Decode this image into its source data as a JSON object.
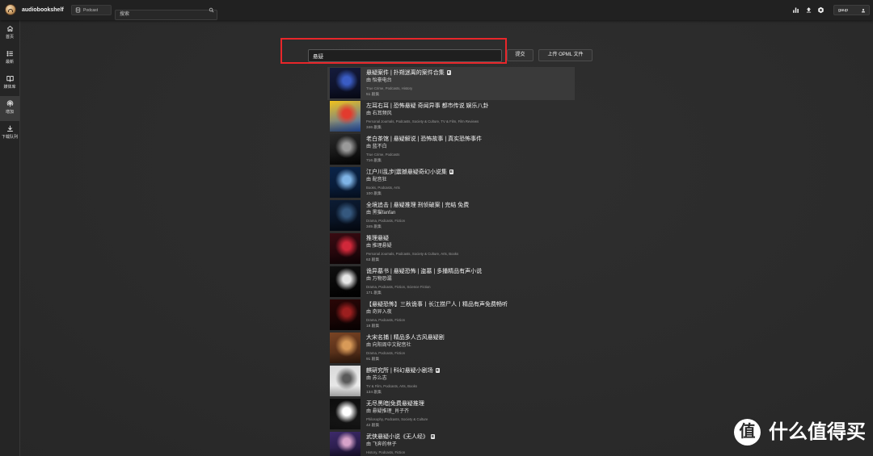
{
  "app": {
    "name": "audiobookshelf",
    "logo_icon": "audiobookshelf-logo-icon"
  },
  "header": {
    "library_selector": {
      "icon": "database-icon",
      "label": "Podcast"
    },
    "search": {
      "icon": "search-icon",
      "placeholder": "搜索"
    },
    "actions": [
      {
        "icon": "stats-icon"
      },
      {
        "icon": "upload-icon"
      },
      {
        "icon": "settings-icon"
      }
    ],
    "user": {
      "name": "gaup",
      "icon": "user-icon"
    }
  },
  "sidebar": {
    "items": [
      {
        "icon": "home-icon",
        "label": "首页",
        "active": false
      },
      {
        "icon": "list-icon",
        "label": "最新",
        "active": false
      },
      {
        "icon": "book-icon",
        "label": "媒体库",
        "active": false
      },
      {
        "icon": "podcast-icon",
        "label": "增加",
        "active": true
      },
      {
        "icon": "download-icon",
        "label": "下载队列",
        "active": false
      }
    ]
  },
  "podcast_search": {
    "query": "悬疑",
    "submit_label": "提交",
    "opml_label": "上传 OPML 文件"
  },
  "annotation": {
    "color": "#e8262a"
  },
  "results": [
    {
      "title": "悬疑案件 | 扑朔迷离的案件合集",
      "badge": "E",
      "author": "由 怡豪电台",
      "categories": "True Crime, Podcasts, History",
      "episodes": "51 剧集",
      "hovered": true,
      "cover_colors": [
        "#151b3c",
        "#3a5cc4",
        "#090c1d"
      ]
    },
    {
      "title": "左耳右耳 | 恐怖悬疑 奇闻异事 都市传说 娱乐八卦",
      "author": "由 右耳频风",
      "categories": "Personal Journals, Podcasts, Society & Culture, TV & Film, Film Reviews",
      "episodes": "346 剧集",
      "hovered": false,
      "cover_colors": [
        "#f2c21c",
        "#e23b2e",
        "#2d5fc4"
      ]
    },
    {
      "title": "老白茶馆 | 悬疑解说 | 恐怖故事 | 真实恐怖事件",
      "author": "由 蓝不白",
      "categories": "True Crime, Podcasts",
      "episodes": "716 剧集",
      "hovered": false,
      "cover_colors": [
        "#2a2a2a",
        "#9a9a9a",
        "#050505"
      ]
    },
    {
      "title": "江户川乱步|震撼悬疑奇幻小说集",
      "badge": "E",
      "author": "由 配音狂",
      "categories": "Books, Podcasts, Arts",
      "episodes": "100 剧集",
      "hovered": false,
      "cover_colors": [
        "#0b2448",
        "#7fb4e6",
        "#06152c"
      ]
    },
    {
      "title": "全境追击 | 悬疑推理 刑侦破案 | 完结 免费",
      "author": "由 黑猫fanfan",
      "categories": "Drama, Podcasts, Fiction",
      "episodes": "345 剧集",
      "hovered": false,
      "cover_colors": [
        "#0c1c34",
        "#35587e",
        "#050b16"
      ]
    },
    {
      "title": "推理悬疑",
      "author": "由 推理悬疑",
      "categories": "Personal Journals, Podcasts, Society & Culture, Arts, Books",
      "episodes": "63 剧集",
      "hovered": false,
      "cover_colors": [
        "#3a0b12",
        "#d1283a",
        "#120306"
      ]
    },
    {
      "title": "诡异墓书 | 悬疑恐怖 | 盗墓 | 多播精品有声小说",
      "author": "由 万物恐漏",
      "categories": "Drama, Podcasts, Fiction, Science Fiction",
      "episodes": "171 剧集",
      "hovered": false,
      "cover_colors": [
        "#101010",
        "#e6e6e6",
        "#000000"
      ]
    },
    {
      "title": "【悬疑恐怖】三秋诡事丨长江捞尸人丨精品有声免费畅听",
      "author": "由 奇异入夜",
      "categories": "Drama, Podcasts, Fiction",
      "episodes": "18 剧集",
      "hovered": false,
      "cover_colors": [
        "#2a0606",
        "#9c1f1f",
        "#0a0202"
      ]
    },
    {
      "title": "大宋名捕 | 精品多人古风悬疑剧",
      "author": "由 向阳周中文配音社",
      "categories": "Drama, Podcasts, Fiction",
      "episodes": "91 剧集",
      "hovered": false,
      "cover_colors": [
        "#7a4424",
        "#d89a58",
        "#3b1f10"
      ]
    },
    {
      "title": "麒研究所 | 科幻悬疑小剧场",
      "badge": "E",
      "author": "由 苏么志",
      "categories": "TV & Film, Podcasts, Arts, Books",
      "episodes": "134 剧集",
      "hovered": false,
      "cover_colors": [
        "#d8d8d8",
        "#5a5a5a",
        "#f4f4f4"
      ]
    },
    {
      "title": "无尽黑暗|免费悬疑推理",
      "author": "由 悬疑推理_肖子齐",
      "categories": "Philosophy, Podcasts, Society & Culture",
      "episodes": "42 剧集",
      "hovered": false,
      "cover_colors": [
        "#0c0c0c",
        "#ffffff",
        "#1a1a1a"
      ]
    },
    {
      "title": "武侠悬疑小说《无人经》",
      "badge": "E",
      "author": "由 飞奔的林子",
      "categories": "History, Podcasts, Fiction",
      "hovered": false,
      "cover_colors": [
        "#3d2a6a",
        "#d7a2c9",
        "#1e1436"
      ]
    }
  ],
  "watermark": {
    "glyph": "值",
    "text": "什么值得买"
  }
}
